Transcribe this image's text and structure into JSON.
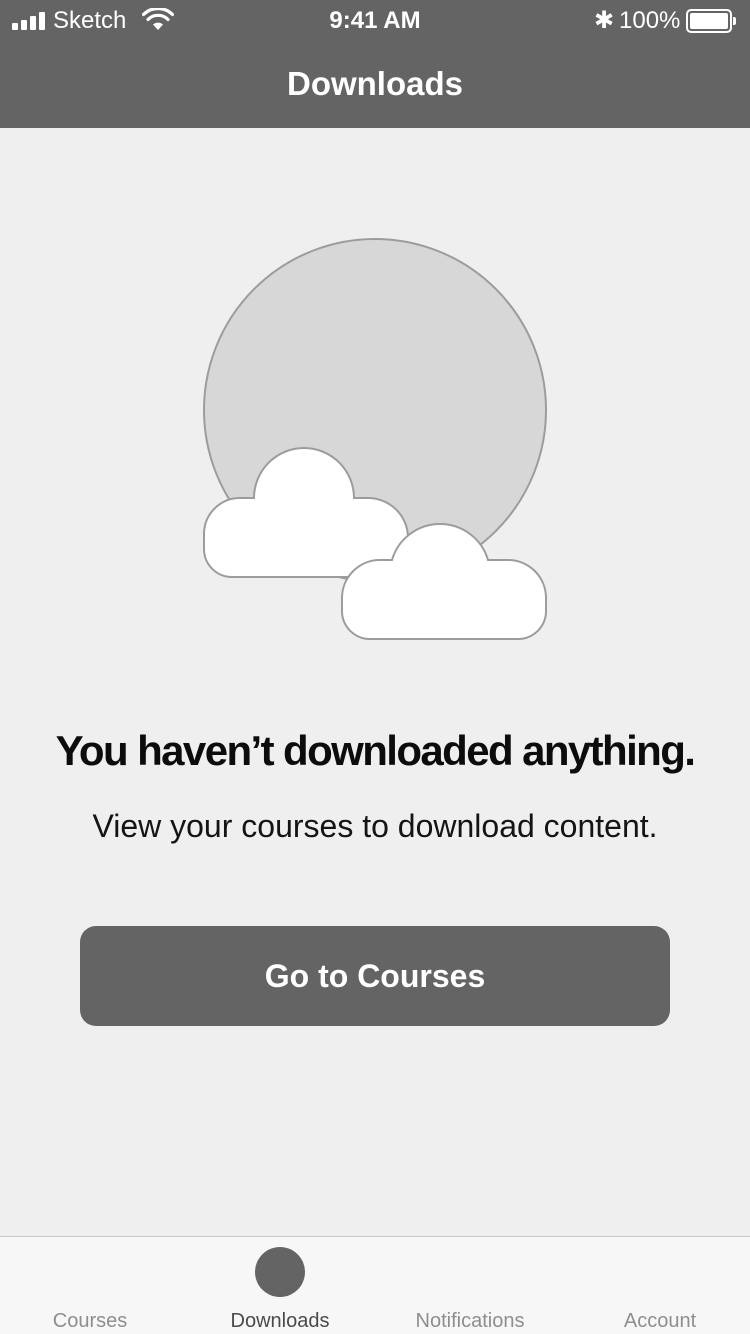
{
  "status_bar": {
    "carrier": "Sketch",
    "time": "9:41 AM",
    "bluetooth_glyph": "✱",
    "battery_percent": "100%",
    "battery_level": 1.0
  },
  "header": {
    "title": "Downloads"
  },
  "empty_state": {
    "illustration": "sun-behind-clouds",
    "headline": "You haven’t downloaded anything.",
    "subtext": "View your courses to download content.",
    "cta_label": "Go to Courses"
  },
  "tabbar": {
    "tabs": [
      {
        "label": "Courses",
        "active": false
      },
      {
        "label": "Downloads",
        "active": true
      },
      {
        "label": "Notifications",
        "active": false
      },
      {
        "label": "Account",
        "active": false
      }
    ]
  },
  "colors": {
    "header_bg": "#646464",
    "page_bg": "#efefef",
    "button_bg": "#646464",
    "tabbar_bg": "#f7f7f7"
  }
}
